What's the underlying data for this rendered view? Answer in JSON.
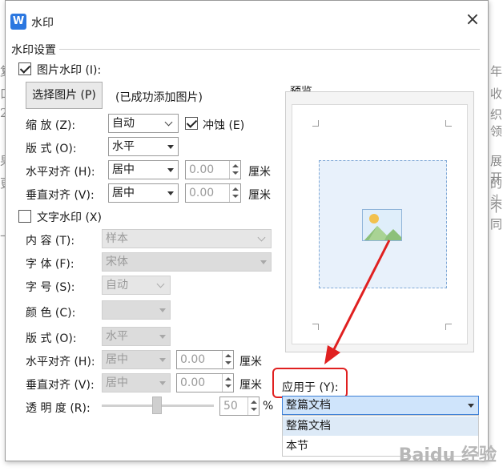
{
  "dialog": {
    "title": "水印",
    "close_glyph": "×",
    "section_title": "水印设置"
  },
  "image_watermark": {
    "checkbox_label": "图片水印 (I):",
    "checked": true,
    "select_button": "选择图片 (P)",
    "status": "(已成功添加图片)",
    "scale_label": "缩  放 (Z):",
    "scale_value": "自动",
    "washout_label": "冲蚀 (E)",
    "washout_checked": true,
    "layout_label": "版  式 (O):",
    "layout_value": "水平",
    "h_align_label": "水平对齐 (H):",
    "h_align_value": "居中",
    "h_offset": "0.00",
    "h_unit": "厘米",
    "v_align_label": "垂直对齐 (V):",
    "v_align_value": "居中",
    "v_offset": "0.00",
    "v_unit": "厘米"
  },
  "text_watermark": {
    "checkbox_label": "文字水印 (X)",
    "checked": false,
    "content_label": "内  容 (T):",
    "content_value": "样本",
    "font_label": "字  体 (F):",
    "font_value": "宋体",
    "size_label": "字  号 (S):",
    "size_value": "自动",
    "color_label": "颜  色 (C):",
    "layout_label": "版  式 (O):",
    "layout_value": "水平",
    "h_align_label": "水平对齐 (H):",
    "h_align_value": "居中",
    "h_offset": "0.00",
    "h_unit": "厘米",
    "v_align_label": "垂直对齐 (V):",
    "v_align_value": "居中",
    "v_offset": "0.00",
    "v_unit": "厘米",
    "transparency_label": "透 明 度 (R):",
    "transparency_value": "50",
    "transparency_unit": "%"
  },
  "preview": {
    "label": "预览"
  },
  "apply": {
    "label": "应用于 (Y):",
    "selected": "整篇文档",
    "options": [
      "整篇文档",
      "本节"
    ]
  },
  "background_text": {
    "left": [
      "复",
      "口",
      "2",
      "果",
      "更",
      "上"
    ],
    "right": [
      "年",
      "收",
      "织领",
      "展开",
      "的头",
      "不同"
    ]
  },
  "watermark_brand": "Baidu 经验",
  "colors": {
    "accent_red": "#e02020",
    "brand_blue": "#2b77e0",
    "highlight": "#ddeaf7"
  }
}
